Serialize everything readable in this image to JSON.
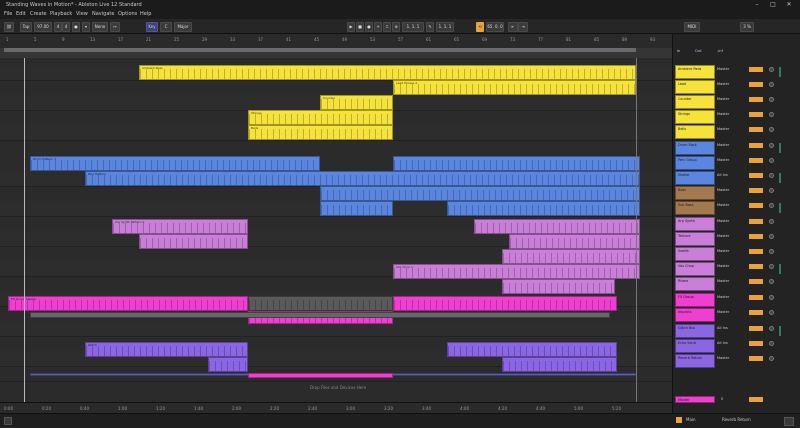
{
  "window": {
    "title": "Standing Waves in Motion* - Ableton Live 12 Standard"
  },
  "menu": [
    "File",
    "Edit",
    "Create",
    "Playback",
    "View",
    "Navigate",
    "Options",
    "Help"
  ],
  "transport": {
    "tap": "Tap",
    "tempo": "97.00",
    "meter_num": "4",
    "meter_den": "4",
    "link": "Link",
    "quant": "None",
    "key": "Major",
    "position": "1. 1. 1",
    "loop_start": "1. 1. 1",
    "loop_len": "65. 0. 0",
    "key_label": "Key",
    "midi": "MIDI",
    "cpu": "3 %"
  },
  "ruler_ticks": [
    "1",
    "5",
    "9",
    "13",
    "17",
    "21",
    "25",
    "29",
    "33",
    "37",
    "41",
    "45",
    "49",
    "53",
    "57",
    "61",
    "65",
    "69",
    "73",
    "77",
    "81",
    "85",
    "89",
    "93"
  ],
  "time_ticks": [
    "0:00",
    "0:20",
    "0:40",
    "1:00",
    "1:20",
    "1:40",
    "2:00",
    "2:20",
    "2:40",
    "3:00",
    "3:20",
    "3:40",
    "4:00",
    "4:20",
    "4:40",
    "5:00",
    "5:20"
  ],
  "tracks": [
    {
      "name": "Ambient Pads",
      "color": "#f5e33b",
      "route": "Master"
    },
    {
      "name": "Lead",
      "color": "#f5e33b",
      "route": "Master"
    },
    {
      "name": "Counter",
      "color": "#f5e33b",
      "route": "Master"
    },
    {
      "name": "Strings",
      "color": "#f5e33b",
      "route": "Master"
    },
    {
      "name": "Bells",
      "color": "#f5e33b",
      "route": "Master"
    },
    {
      "name": "Drum Rack",
      "color": "#5b86e0",
      "route": "Master"
    },
    {
      "name": "Perc Group",
      "color": "#5b86e0",
      "route": "Master"
    },
    {
      "name": "Shaker",
      "color": "#5b86e0",
      "route": "All Ins"
    },
    {
      "name": "Bass",
      "color": "#a37a4f",
      "route": "Master"
    },
    {
      "name": "Sub Bass",
      "color": "#a37a4f",
      "route": "Master"
    },
    {
      "name": "Arp Synth",
      "color": "#c97ed8",
      "route": "Master"
    },
    {
      "name": "Texture",
      "color": "#c97ed8",
      "route": "Master"
    },
    {
      "name": "Swells",
      "color": "#c97ed8",
      "route": "Master"
    },
    {
      "name": "Vox Chop",
      "color": "#c97ed8",
      "route": "Master"
    },
    {
      "name": "Risers",
      "color": "#c97ed8",
      "route": "Master"
    },
    {
      "name": "FX Group",
      "color": "#f03ed0",
      "route": "Master"
    },
    {
      "name": "Impacts",
      "color": "#f03ed0",
      "route": "Master"
    },
    {
      "name": "Glitch Bus",
      "color": "#8b66e3",
      "route": "All Ins"
    },
    {
      "name": "Echo Send",
      "color": "#8b66e3",
      "route": "All Ins"
    },
    {
      "name": "Reverb Return",
      "color": "#8b66e3",
      "route": "Master"
    }
  ],
  "mixer_header": {
    "in": "In",
    "out": "Out",
    "vol": "-inf"
  },
  "clips": [
    {
      "lane": 0,
      "label": "Ambient Pads"
    },
    {
      "lane": 1,
      "label": "Lead Phrase A"
    },
    {
      "lane": 2,
      "label": "Counter"
    },
    {
      "lane": 3,
      "label": "Strings"
    },
    {
      "lane": 4,
      "label": "Bells"
    },
    {
      "lane": 5,
      "label": "Drum Pattern 1"
    },
    {
      "lane": 6,
      "label": "Perc Pattern"
    },
    {
      "lane": 10,
      "label": "Arp Synth Pattern 2"
    },
    {
      "lane": 13,
      "label": "Vox Chop 1"
    },
    {
      "lane": 15,
      "label": "FX Group Sweep"
    },
    {
      "lane": 17,
      "label": "Glitch"
    }
  ],
  "footer_label": "Drop Files and Devices Here",
  "master": {
    "name": "Master",
    "color": "#f03ed0",
    "value": "0"
  },
  "statusbar": {
    "left": "Main",
    "right": "Reverb Return"
  },
  "colors": {
    "accent": "#e8a33d",
    "yellow": "#f5e33b",
    "blue": "#5b86e0",
    "brown": "#a37a4f",
    "lilac": "#c97ed8",
    "magenta": "#f03ed0",
    "purple": "#8b66e3"
  }
}
